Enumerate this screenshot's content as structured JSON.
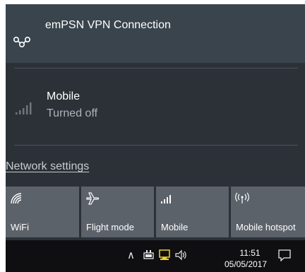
{
  "vpn": {
    "label": "emPSN VPN Connection",
    "icon": "vpn-icon"
  },
  "mobile": {
    "name": "Mobile",
    "status": "Turned off",
    "icon": "cellular-signal-icon"
  },
  "network_settings_label": "Network settings",
  "tiles": [
    {
      "label": "WiFi",
      "icon": "wifi-icon"
    },
    {
      "label": "Flight mode",
      "icon": "airplane-icon"
    },
    {
      "label": "Mobile",
      "icon": "cellular-signal-icon"
    },
    {
      "label": "Mobile hotspot",
      "icon": "hotspot-icon"
    }
  ],
  "taskbar": {
    "time": "11:51",
    "date": "05/05/2017"
  },
  "colors": {
    "flyout_bg": "#2b3137",
    "vpn_bg": "#3a444c",
    "tile_bg": "#5c6269",
    "taskbar_bg": "#0f0f12",
    "tray_network_warning": "#f3d22b"
  }
}
